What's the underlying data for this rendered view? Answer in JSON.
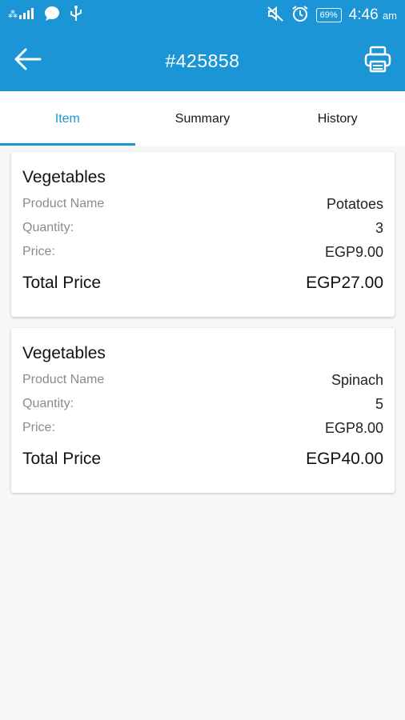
{
  "status_bar": {
    "time": "4:46",
    "time_suffix": "am",
    "battery": "69%",
    "icons": [
      "signal-icon",
      "chat-icon",
      "usb-icon",
      "mute-icon",
      "alarm-icon",
      "battery-icon"
    ]
  },
  "header": {
    "title": "#425858",
    "back_icon": "arrow-left-icon",
    "print_icon": "printer-icon"
  },
  "tabs": [
    {
      "label": "Item",
      "active": true
    },
    {
      "label": "Summary",
      "active": false
    },
    {
      "label": "History",
      "active": false
    }
  ],
  "items": [
    {
      "category": "Vegetables",
      "product_name_label": "Product Name",
      "product_name": "Potatoes",
      "quantity_label": "Quantity:",
      "quantity": "3",
      "price_label": "Price:",
      "price": "EGP9.00",
      "total_label": "Total Price",
      "total": "EGP27.00"
    },
    {
      "category": "Vegetables",
      "product_name_label": "Product Name",
      "product_name": "Spinach",
      "quantity_label": "Quantity:",
      "quantity": "5",
      "price_label": "Price:",
      "price": "EGP8.00",
      "total_label": "Total Price",
      "total": "EGP40.00"
    }
  ],
  "colors": {
    "primary": "#1b95d6",
    "background": "#f7f7f7",
    "muted_label": "#8b8b8b"
  }
}
